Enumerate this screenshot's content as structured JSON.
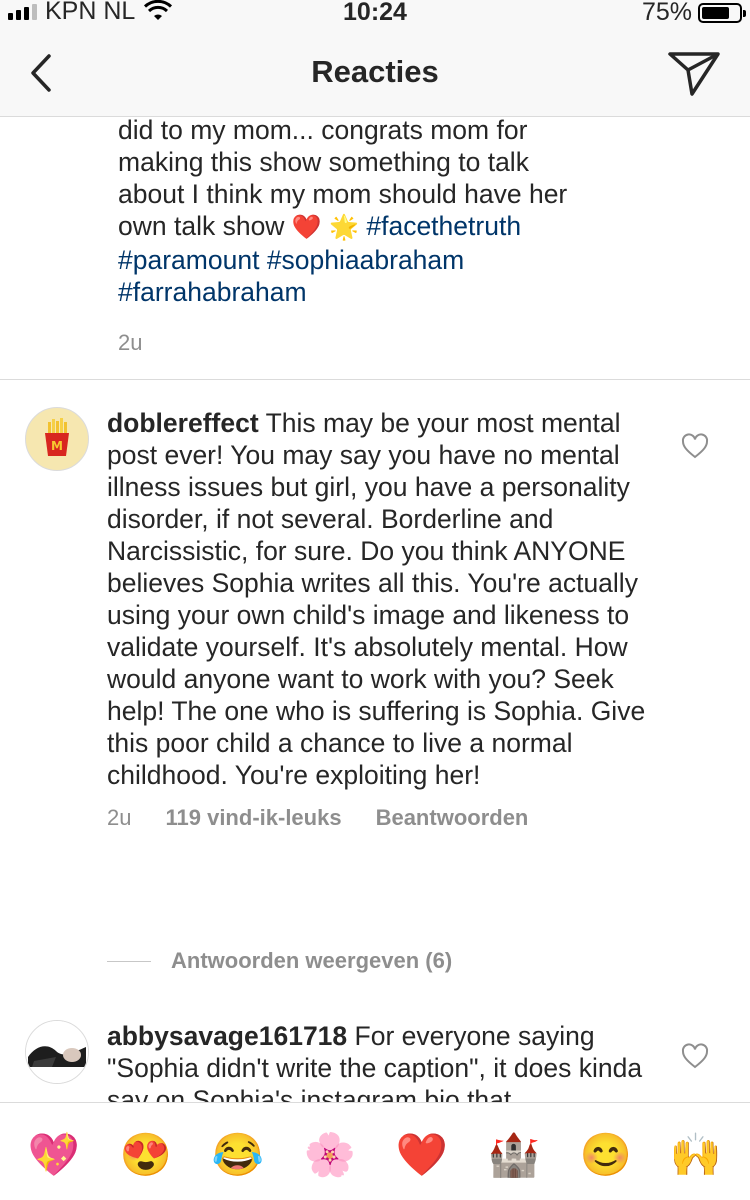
{
  "status_bar": {
    "carrier": "KPN NL",
    "time": "10:24",
    "battery_percent": "75%",
    "battery_level": 0.75,
    "signal_bars": 3
  },
  "header": {
    "title": "Reacties",
    "back_icon": "chevron-left-icon",
    "send_icon": "paper-plane-icon"
  },
  "comments": [
    {
      "text_lines": [
        "did to my mom... congrats mom for",
        "making this show something to talk",
        "about I think my mom should have her"
      ],
      "line4_text": "own talk show",
      "line4_emojis": [
        "❤️",
        "🌟"
      ],
      "hashtags": [
        "#facethetruth",
        "#paramount",
        "#sophiaabraham",
        "#farrahabraham"
      ],
      "time": "2u"
    },
    {
      "username": "doblereffect",
      "avatar_icon": "fries-avatar-icon",
      "text": "This may be your most mental post ever!  You may say you have no mental illness issues but girl, you have a personality disorder, if not several.  Borderline and Narcissistic, for sure.  Do you think ANYONE believes Sophia writes all this.  You're actually using your own child's image and likeness to validate yourself.  It's absolutely mental.  How would anyone want to work with you?  Seek help!  The one who is suffering is Sophia.  Give this poor child a chance to live a normal childhood.  You're exploiting her!",
      "time": "2u",
      "likes": "119 vind-ik-leuks",
      "reply_label": "Beantwoorden",
      "view_replies": "Antwoorden weergeven (6)"
    },
    {
      "username": "abbysavage161718",
      "avatar_icon": "photo-avatar-icon",
      "text": "For everyone saying \"Sophia didn't write the caption\", it does kinda say on Sophia's instagram bio that"
    }
  ],
  "emoji_bar": [
    "💖",
    "😍",
    "😂",
    "🌸",
    "❤️",
    "🏰",
    "😊",
    "🙌"
  ],
  "colors": {
    "hashtag": "#003569",
    "secondary_text": "#8e8e8e",
    "divider": "#dbdbdb",
    "header_bg": "#f8f8f8"
  }
}
